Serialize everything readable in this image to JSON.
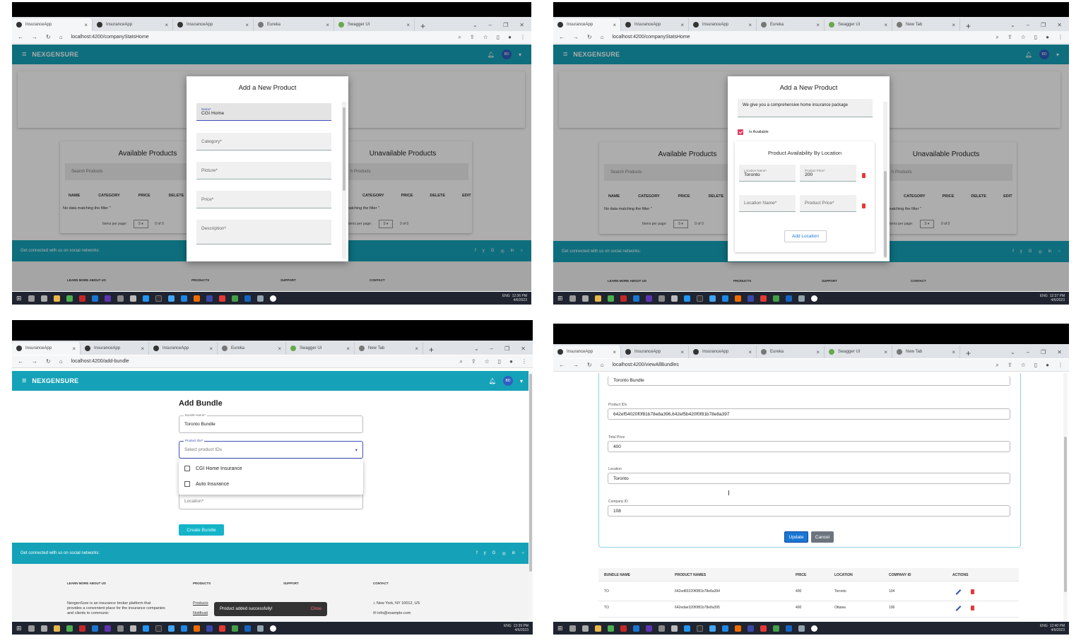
{
  "browser": {
    "tabs1": [
      "InsuranceApp",
      "InsuranceApp",
      "InsuranceApp",
      "Eureka",
      "Swagger UI"
    ],
    "tabs2": [
      "InsuranceApp",
      "InsuranceApp",
      "InsuranceApp",
      "Eureka",
      "Swagger UI",
      "New Tab"
    ],
    "url1": "localhost:4200/companyStatsHome",
    "url2": "localhost:4200/companyStatsHome",
    "url3": "localhost:4200/add-bundle",
    "url4": "localhost:4200/viewAllBundles"
  },
  "app": {
    "brand": "NEXGENSURE",
    "avatar": "BD"
  },
  "stats": {
    "available_title": "Available Products",
    "unavailable_title": "Unavailable Products",
    "search_placeholder": "Search Products",
    "search_partial": "h Products",
    "cols": [
      "NAME",
      "CATEGORY",
      "PRICE",
      "DELETE"
    ],
    "cols_right": [
      "CATEGORY",
      "PRICE",
      "DELETE",
      "EDIT"
    ],
    "no_data": "No data matching the filter \"",
    "no_data_partial": "matching the filter \"",
    "items_per_page": "Items per page:",
    "items_per_page_partial": "tems per page:",
    "page_size": "5",
    "range": "0 of 0"
  },
  "footer": {
    "social": "Get connected with us on social networks:",
    "social_icons": [
      "f",
      "y",
      "G",
      "◎",
      "in",
      "○"
    ],
    "learn": "LEARN MORE ABOUT US",
    "products": "PRODUCTS",
    "support": "SUPPORT",
    "contact": "CONTACT",
    "about_text": "NexgenSure is an insurance broker platform that provides a convenient place for the insurance companies and clients to communic",
    "products_link": "Products",
    "notif_link": "Notificati",
    "address": "New York, NY 10012, US",
    "email": "info@example.com"
  },
  "modal1": {
    "title": "Add a New Product",
    "name_label": "Name*",
    "name_value": "CGI Home",
    "category": "Category*",
    "picture": "Picture*",
    "price": "Price*",
    "description": "Description*"
  },
  "modal2": {
    "title": "Add a New Product",
    "description": "We give you a comprehensive home insurance package",
    "is_available": "Is Available",
    "section_title": "Product Availability By Location",
    "loc_label": "Location Name*",
    "loc_value": "Toronto",
    "price_label": "Product Price*",
    "price_value": "200",
    "loc2": "Location Name*",
    "price2": "Product Price*",
    "add_location": "Add Location"
  },
  "bundle": {
    "title": "Add Bundle",
    "bundle_label": "Bundle Name*",
    "bundle_value": "Toronto Bundle",
    "ids_label": "Product IDs*",
    "ids_placeholder": "Select product IDs",
    "options": [
      "CGI Home Insurance",
      "Auto Insurance"
    ],
    "location": "Location*",
    "create": "Create Bundle",
    "snack": "Product added successfully!",
    "snack_action": "Close"
  },
  "edit": {
    "bundle_value": "Toronto Bundle",
    "ids_label": "Product IDs",
    "ids_value": "642ef54020f0f81b78e8a396,642ef5b420f0f81b78e8a397",
    "total_label": "Total Price",
    "total_value": "400",
    "loc_label": "Location",
    "loc_value": "Toronto",
    "company_label": "Company ID",
    "company_value": "108",
    "update": "Update",
    "cancel": "Cancel",
    "cols": [
      "BUNDLE NAME",
      "PRODUCT NAMES",
      "PRICE",
      "LOCATION",
      "COMPANY ID",
      "ACTIONS"
    ],
    "rows": [
      [
        "TO",
        "642ed83220f0f81b78e8a394",
        "400",
        "Toronto",
        "104"
      ],
      [
        "TO",
        "642edae320f0f81b78e8a395",
        "400",
        "Ottawa",
        "106"
      ]
    ]
  },
  "taskbar": {
    "t1": "12:36 PM",
    "t2": "12:37 PM",
    "t3": "12:39 PM",
    "t4": "12:40 PM",
    "date": "4/6/2023",
    "lang": "ENG"
  }
}
